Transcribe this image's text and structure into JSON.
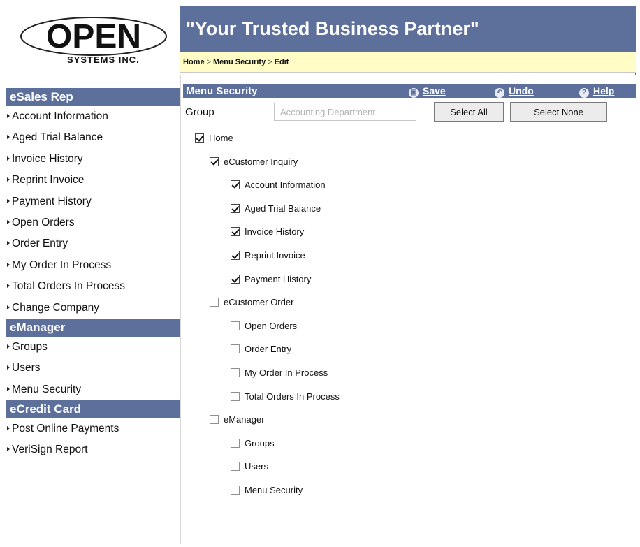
{
  "logo": {
    "wordmark": "OPEN",
    "subtitle": "SYSTEMS INC."
  },
  "header": {
    "title": "\"Your Trusted Business Partner\""
  },
  "breadcrumb": {
    "items": [
      "Home",
      "Menu Security",
      "Edit"
    ],
    "separator": ">"
  },
  "sidebar": {
    "sections": [
      {
        "title": "eSales Rep",
        "items": [
          "Account Information",
          "Aged Trial Balance",
          "Invoice History",
          "Reprint Invoice",
          "Payment History",
          "Open Orders",
          "Order Entry",
          "My Order In Process",
          "Total Orders In Process",
          "Change Company"
        ]
      },
      {
        "title": "eManager",
        "items": [
          "Groups",
          "Users",
          "Menu Security"
        ]
      },
      {
        "title": "eCredit Card",
        "items": [
          "Post Online Payments",
          "VeriSign Report"
        ]
      }
    ]
  },
  "panel": {
    "title": "Menu Security",
    "save_label": "Save",
    "undo_label": "Undo",
    "help_label": "Help"
  },
  "group": {
    "label": "Group",
    "value": "Accounting Department",
    "select_all_label": "Select All",
    "select_none_label": "Select None"
  },
  "tree": [
    {
      "label": "Home",
      "level": 0,
      "checked": true
    },
    {
      "label": "eCustomer Inquiry",
      "level": 1,
      "checked": true
    },
    {
      "label": "Account Information",
      "level": 2,
      "checked": true
    },
    {
      "label": "Aged Trial Balance",
      "level": 2,
      "checked": true
    },
    {
      "label": "Invoice History",
      "level": 2,
      "checked": true
    },
    {
      "label": "Reprint Invoice",
      "level": 2,
      "checked": true
    },
    {
      "label": "Payment History",
      "level": 2,
      "checked": true
    },
    {
      "label": "eCustomer Order",
      "level": 1,
      "checked": false
    },
    {
      "label": "Open Orders",
      "level": 2,
      "checked": false
    },
    {
      "label": "Order Entry",
      "level": 2,
      "checked": false
    },
    {
      "label": "My Order In Process",
      "level": 2,
      "checked": false
    },
    {
      "label": "Total Orders In Process",
      "level": 2,
      "checked": false
    },
    {
      "label": "eManager",
      "level": 1,
      "checked": false
    },
    {
      "label": "Groups",
      "level": 2,
      "checked": false
    },
    {
      "label": "Users",
      "level": 2,
      "checked": false
    },
    {
      "label": "Menu Security",
      "level": 2,
      "checked": false
    }
  ],
  "colors": {
    "brand": "#5d6f9b",
    "breadcrumb_bg": "#fffcc6"
  }
}
